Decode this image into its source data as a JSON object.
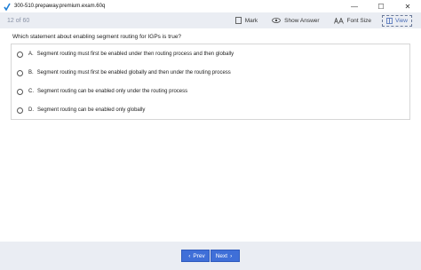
{
  "window": {
    "title": "300-510.prepaway.premium.exam.60q",
    "controls": {
      "minimize": "—",
      "maximize": "☐",
      "close": "✕"
    }
  },
  "toolbar": {
    "counter": "12 of 60",
    "mark_label": "Mark",
    "show_answer_label": "Show Answer",
    "font_size_label": "Font Size",
    "view_label": "View"
  },
  "question": {
    "text": "Which statement about enabling segment routing for IGPs is true?",
    "options": [
      {
        "letter": "A.",
        "text": "Segment routing must first be enabled under then routing process and then globally"
      },
      {
        "letter": "B.",
        "text": "Segment routing must first be enabled globally and then under the routing process"
      },
      {
        "letter": "C.",
        "text": "Segment routing can be enabled only under the routing process"
      },
      {
        "letter": "D.",
        "text": "Segment routing can be enabled only globally"
      }
    ]
  },
  "navigation": {
    "prev_label": "Prev",
    "next_label": "Next"
  },
  "colors": {
    "toolbar_bg": "#eaedf3",
    "accent": "#3f6fd8",
    "counter": "#8a93a6"
  }
}
